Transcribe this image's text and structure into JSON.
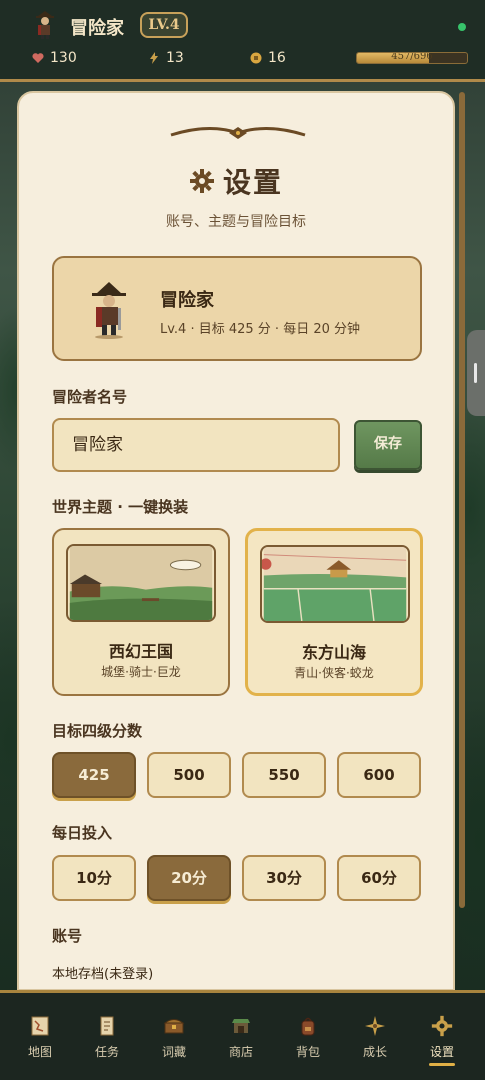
{
  "header": {
    "title": "冒险家",
    "level_badge": "LV.4",
    "stats": {
      "hearts": "130",
      "energy": "13",
      "coins": "16"
    },
    "xp": {
      "label": "457/696",
      "current": 457,
      "max": 696
    },
    "online_color": "#37c36b"
  },
  "settings": {
    "title": "设置",
    "subtitle": "账号、主题与冒险目标",
    "profile": {
      "name": "冒险家",
      "meta": "Lv.4 · 目标 425 分 · 每日 20 分钟"
    },
    "name_section": {
      "label": "冒险者名号",
      "value": "冒险家",
      "save_label": "保存"
    },
    "theme_section": {
      "label": "世界主题 · 一键换装",
      "themes": [
        {
          "name": "西幻王国",
          "desc": "城堡·骑士·巨龙",
          "selected": false
        },
        {
          "name": "东方山海",
          "desc": "青山·侠客·蛟龙",
          "selected": true
        }
      ]
    },
    "target_section": {
      "label": "目标四级分数",
      "options": [
        "425",
        "500",
        "550",
        "600"
      ],
      "selected": "425"
    },
    "daily_section": {
      "label": "每日投入",
      "options": [
        "10分",
        "20分",
        "30分",
        "60分"
      ],
      "selected": "20分"
    },
    "account_section": {
      "label": "账号",
      "value": "本地存档(未登录)"
    }
  },
  "nav": {
    "items": [
      {
        "label": "地图",
        "icon": "map-icon"
      },
      {
        "label": "任务",
        "icon": "quest-scroll-icon"
      },
      {
        "label": "词藏",
        "icon": "treasure-chest-icon"
      },
      {
        "label": "商店",
        "icon": "shop-stall-icon"
      },
      {
        "label": "背包",
        "icon": "backpack-icon"
      },
      {
        "label": "成长",
        "icon": "growth-compass-icon"
      },
      {
        "label": "设置",
        "icon": "gear-icon"
      }
    ],
    "active": "设置"
  },
  "colors": {
    "accent_gold": "#e0b046",
    "panel_bg": "#f6eedd",
    "save_green": "#6f9660",
    "selected_brown": "#8a6a3c"
  }
}
